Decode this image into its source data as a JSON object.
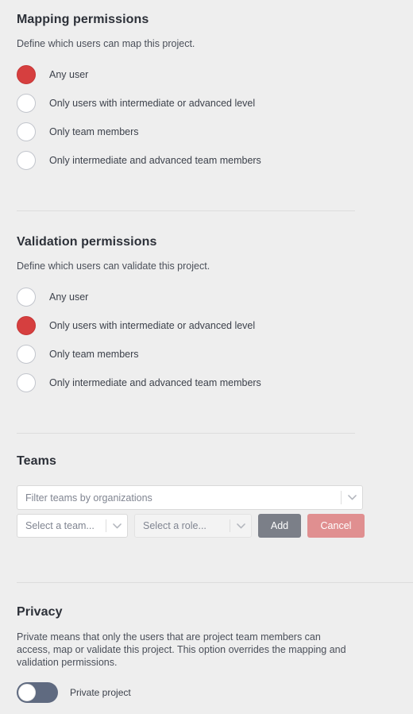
{
  "theme": {
    "background": "#eeeeee",
    "accent_red": "#d63f3f",
    "heading_color": "#2c3038",
    "toggle_track": "#5f6a80",
    "add_button_color": "#7b7f88",
    "cancel_button_color": "#e08f90"
  },
  "mapping": {
    "title": "Mapping permissions",
    "description": "Define which users can map this project.",
    "options": [
      {
        "label": "Any user",
        "selected": true
      },
      {
        "label": "Only users with intermediate or advanced level",
        "selected": false
      },
      {
        "label": "Only team members",
        "selected": false
      },
      {
        "label": "Only intermediate and advanced team members",
        "selected": false
      }
    ]
  },
  "validation": {
    "title": "Validation permissions",
    "description": "Define which users can validate this project.",
    "options": [
      {
        "label": "Any user",
        "selected": false
      },
      {
        "label": "Only users with intermediate or advanced level",
        "selected": true
      },
      {
        "label": "Only team members",
        "selected": false
      },
      {
        "label": "Only intermediate and advanced team members",
        "selected": false
      }
    ]
  },
  "teams": {
    "title": "Teams",
    "organization_filter": {
      "value": "Filter teams by organizations",
      "placeholder": "Filter teams by organizations",
      "arrow_icon": "chevron-down-icon"
    },
    "team_select": {
      "value": "Select a team...",
      "placeholder": "Select a team...",
      "arrow_icon": "chevron-down-icon"
    },
    "role_select": {
      "value": "Select a role...",
      "placeholder": "Select a role...",
      "arrow_icon": "chevron-down-icon"
    },
    "add_label": "Add",
    "cancel_label": "Cancel"
  },
  "privacy": {
    "title": "Privacy",
    "description": "Private means that only the users that are project team members can access, map or validate this project. This option overrides the mapping and validation permissions.",
    "toggle_label": "Private project",
    "toggle_on": false
  }
}
